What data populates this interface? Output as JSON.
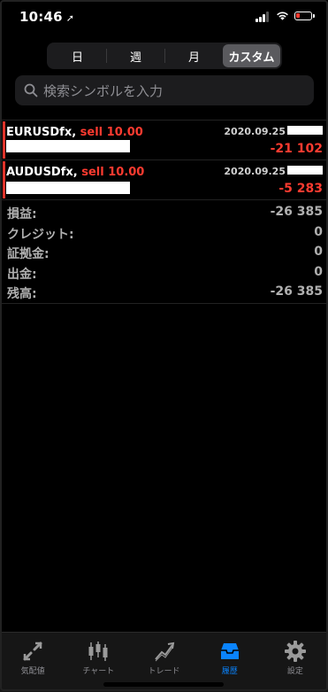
{
  "status_bar": {
    "time": "10:46"
  },
  "period_tabs": [
    {
      "label": "日",
      "selected": false
    },
    {
      "label": "週",
      "selected": false
    },
    {
      "label": "月",
      "selected": false
    },
    {
      "label": "カスタム",
      "selected": true
    }
  ],
  "search": {
    "placeholder": "検索シンボルを入力"
  },
  "deals": [
    {
      "symbol": "EURUSDfx,",
      "side": "sell 10.00",
      "date": "2020.09.25",
      "profit": "-21 102"
    },
    {
      "symbol": "AUDUSDfx,",
      "side": "sell 10.00",
      "date": "2020.09.25",
      "profit": "-5 283"
    }
  ],
  "summary": [
    {
      "label": "損益:",
      "value": "-26 385"
    },
    {
      "label": "クレジット:",
      "value": "0"
    },
    {
      "label": "証拠金:",
      "value": "0"
    },
    {
      "label": "出金:",
      "value": "0"
    },
    {
      "label": "残高:",
      "value": "-26 385"
    }
  ],
  "tabbar": [
    {
      "label": "気配値",
      "icon": "quotes-icon",
      "active": false
    },
    {
      "label": "チャート",
      "icon": "chart-icon",
      "active": false
    },
    {
      "label": "トレード",
      "icon": "trade-icon",
      "active": false
    },
    {
      "label": "履歴",
      "icon": "history-icon",
      "active": true
    },
    {
      "label": "設定",
      "icon": "settings-icon",
      "active": false
    }
  ],
  "colors": {
    "accent": "#0a84ff",
    "loss": "#ff3b30",
    "background": "#000000"
  }
}
